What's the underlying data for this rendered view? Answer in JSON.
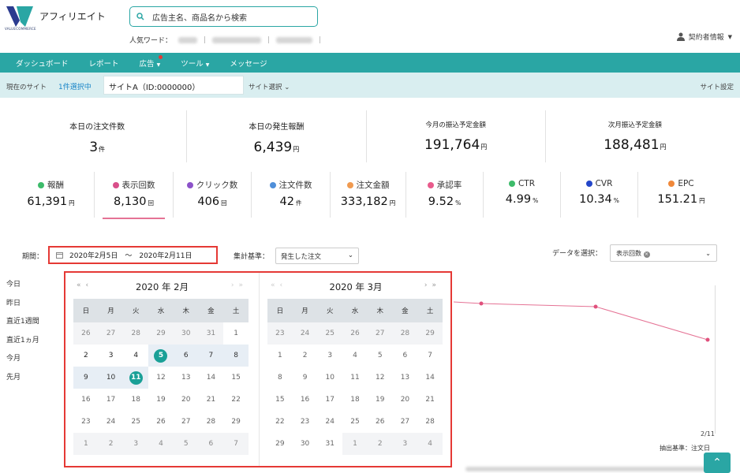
{
  "header": {
    "logo_text": "VALUECOMMERCE",
    "app_name": "アフィリエイト",
    "search_placeholder": "広告主名、商品名から検索",
    "popular_label": "人気ワード：",
    "account": "契約者情報"
  },
  "nav": {
    "items": [
      "ダッシュボード",
      "レポート",
      "広告",
      "ツール",
      "メッセージ"
    ]
  },
  "site_bar": {
    "current_label": "現在のサイト",
    "selected_count": "1件選択中",
    "site_name": "サイトA（ID:0000000）",
    "site_select": "サイト選択",
    "site_setting": "サイト設定"
  },
  "stats": [
    {
      "label": "本日の注文件数",
      "value": "3",
      "unit": "件"
    },
    {
      "label": "本日の発生報酬",
      "value": "6,439",
      "unit": "円"
    },
    {
      "label": "今月の振込予定金額",
      "value": "191,764",
      "unit": "円"
    },
    {
      "label": "次月振込予定金額",
      "value": "188,481",
      "unit": "円"
    }
  ],
  "metrics": [
    {
      "label": "報酬",
      "value": "61,391",
      "unit": "円",
      "color": "#3dbb6a"
    },
    {
      "label": "表示回数",
      "value": "8,130",
      "unit": "回",
      "color": "#d94f8a"
    },
    {
      "label": "クリック数",
      "value": "406",
      "unit": "回",
      "color": "#8c52c9"
    },
    {
      "label": "注文件数",
      "value": "42",
      "unit": "件",
      "color": "#4f8fd9"
    },
    {
      "label": "注文金額",
      "value": "333,182",
      "unit": "円",
      "color": "#f09a50"
    },
    {
      "label": "承認率",
      "value": "9.52",
      "unit": "%",
      "color": "#e85b8c"
    },
    {
      "label": "CTR",
      "value": "4.99",
      "unit": "%",
      "color": "#3dbb6a"
    },
    {
      "label": "CVR",
      "value": "10.34",
      "unit": "%",
      "color": "#2446c9"
    },
    {
      "label": "EPC",
      "value": "151.21",
      "unit": "円",
      "color": "#f0883a"
    }
  ],
  "filters": {
    "period_label": "期間：",
    "period_value": "2020年2月5日　〜　2020年2月11日",
    "agg_label": "集計基準：",
    "agg_value": "発生した注文",
    "data_label": "データを選択：",
    "data_value": "表示回数"
  },
  "presets": [
    "今日",
    "昨日",
    "直近1週間",
    "直近1ヵ月",
    "今月",
    "先月"
  ],
  "calendar": {
    "weekdays": [
      "日",
      "月",
      "火",
      "水",
      "木",
      "金",
      "土"
    ],
    "months": [
      {
        "title": "2020 年 2月",
        "days": [
          "26",
          "27",
          "28",
          "29",
          "30",
          "31",
          "1",
          "2",
          "3",
          "4",
          "5",
          "6",
          "7",
          "8",
          "9",
          "10",
          "11",
          "12",
          "13",
          "14",
          "15",
          "16",
          "17",
          "18",
          "19",
          "20",
          "21",
          "22",
          "23",
          "24",
          "25",
          "26",
          "27",
          "28",
          "29",
          "1",
          "2",
          "3",
          "4",
          "5",
          "6",
          "7"
        ]
      },
      {
        "title": "2020 年 3月",
        "days": [
          "23",
          "24",
          "25",
          "26",
          "27",
          "28",
          "29",
          "1",
          "2",
          "3",
          "4",
          "5",
          "6",
          "7",
          "8",
          "9",
          "10",
          "11",
          "12",
          "13",
          "14",
          "15",
          "16",
          "17",
          "18",
          "19",
          "20",
          "21",
          "22",
          "23",
          "24",
          "25",
          "26",
          "27",
          "28",
          "29",
          "30",
          "31",
          "1",
          "2",
          "3",
          "4"
        ]
      }
    ]
  },
  "chart_data": {
    "type": "line",
    "x_tick": "2/11",
    "basis": "抽出基準：注文日",
    "color": "#e57395"
  }
}
